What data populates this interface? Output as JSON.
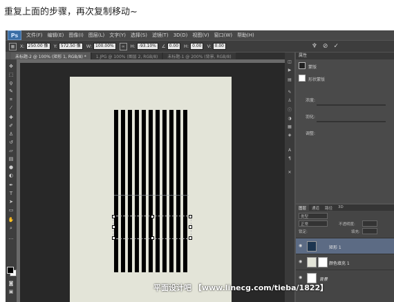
{
  "caption": "重复上面的步骤，再次复制移动~",
  "app": {
    "logo": "Ps",
    "menu": [
      "文件(F)",
      "编辑(E)",
      "图像(I)",
      "图层(L)",
      "文字(Y)",
      "选择(S)",
      "滤镜(T)",
      "3D(D)",
      "视图(V)",
      "窗口(W)",
      "帮助(H)"
    ]
  },
  "options": {
    "x_label": "X:",
    "x_value": "250.00 像",
    "y_label": "Y:",
    "y_value": "572.50 像",
    "w_label": "W:",
    "w_value": "100.00%",
    "h_label": "H:",
    "h_value": "-93.10%",
    "angle_value": "0.00",
    "hskew_label": "H:",
    "hskew_value": "0.00",
    "vskew_label": "V:",
    "vskew_value": "0.00"
  },
  "tabs": [
    "未标题-2 @ 100% (矩形 1, RGB/8) *",
    "1.JPG @ 100% (图层 2, RGB/8)",
    "未标题-1 @ 200% (背景, RGB/8)"
  ],
  "canvas": {
    "bar_count": 11,
    "document_color": "#e3e4d8",
    "bar_color": "#000000"
  },
  "properties": {
    "header": "属性",
    "mask_label": "蒙版",
    "shape_mask_label": "形状蒙版",
    "density_label": "浓度:",
    "feather_label": "羽化:",
    "refine_label": "调整:"
  },
  "layers": {
    "tabs": [
      "图层",
      "通道",
      "路径",
      "3D"
    ],
    "kind_label": "类型",
    "blend_mode": "正常",
    "opacity_label": "不透明度:",
    "lock_label": "锁定:",
    "fill_label": "填充:",
    "items": [
      {
        "name": "矩形 1",
        "selected": true
      },
      {
        "name": "颜色填充 1",
        "selected": false
      },
      {
        "name": "背景",
        "selected": false
      }
    ]
  },
  "watermark": "平面设计吧 【www.linecg.com/tieba/1822】"
}
